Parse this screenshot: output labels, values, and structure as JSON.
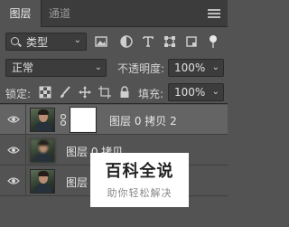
{
  "tabs": [
    {
      "label": "图层",
      "active": true
    },
    {
      "label": "通道",
      "active": false
    }
  ],
  "filter": {
    "label": "类型"
  },
  "blend": {
    "mode": "正常",
    "opacity_label": "不透明度:",
    "opacity_value": "100%"
  },
  "lock": {
    "label": "锁定:",
    "fill_label": "填充:",
    "fill_value": "100%"
  },
  "layers": [
    {
      "name": "图层 0 拷贝 2",
      "visible": true,
      "selected": true,
      "has_mask": true
    },
    {
      "name": "图层 0 拷贝",
      "visible": true,
      "selected": false,
      "has_mask": false
    },
    {
      "name": "图层 0",
      "visible": true,
      "selected": false,
      "has_mask": false
    }
  ],
  "watermark": {
    "title": "百科全说",
    "subtitle": "助你轻松解决"
  },
  "colors": {
    "panel": "#535353",
    "tabbar": "#3c3c3c",
    "selected_row": "#646464"
  }
}
